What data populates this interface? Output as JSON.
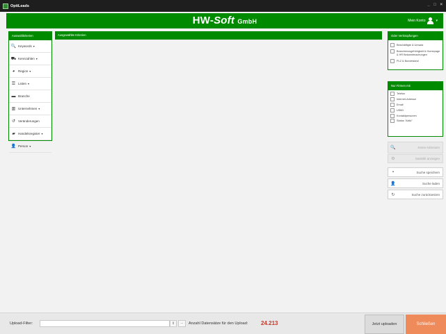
{
  "window": {
    "title": "OptiLeads",
    "controls": "_ □ ×"
  },
  "header": {
    "brand_prefix": "HW-",
    "brand_soft": "Soft",
    "brand_suffix": "GmbH",
    "account_label": "Mein Konto",
    "account_caret": "▾"
  },
  "left_panel": {
    "title": "Auswahlkriterien",
    "items": [
      {
        "label": "Keywords",
        "icon": "keyword-search-icon",
        "glyph": "🔍",
        "dropdown": true
      },
      {
        "label": "Kennzahlen",
        "icon": "cars-icon",
        "glyph": "⛟",
        "dropdown": true
      },
      {
        "label": "Region",
        "icon": "globe-icon",
        "glyph": "◕",
        "dropdown": true
      },
      {
        "label": "Listen",
        "icon": "list-icon",
        "glyph": "☰",
        "dropdown": true
      },
      {
        "label": "Branche",
        "icon": "briefcase-icon",
        "glyph": "▬",
        "dropdown": false
      },
      {
        "label": "Unternehmen",
        "icon": "building-icon",
        "glyph": "▥",
        "dropdown": true
      },
      {
        "label": "Veränderungen",
        "icon": "history-icon",
        "glyph": "↺",
        "dropdown": false
      },
      {
        "label": "Handelsregister",
        "icon": "book-icon",
        "glyph": "▰",
        "dropdown": true
      },
      {
        "label": "Person",
        "icon": "person-icon",
        "glyph": "👤",
        "dropdown": true
      }
    ],
    "caret": "▾"
  },
  "center_panel": {
    "title": "Ausgewählte Kriterien"
  },
  "right_panel_1": {
    "title": "Oder Verknüpfungen",
    "options": [
      "Beschäftigte & Umsatz",
      "Branchenzugehörigkeit & Homepage & HR Bekanntmachungen",
      "PLZ & Bundesland"
    ]
  },
  "right_panel_2": {
    "title": "Nur Firmen mit",
    "options": [
      "Telefon",
      "Internet-Adresse",
      "Email",
      "UStID",
      "Kontaktpersonen",
      "Status \"Aktiv\""
    ]
  },
  "side_buttons": {
    "keine_adressen": "Keine Adressen",
    "statistik": "Statistik anzeigen",
    "suche_speichern": "Suche speichern",
    "suche_laden": "Suche laden",
    "suche_zuruecksetzen": "Suche zurücksetzen"
  },
  "footer": {
    "filter_label": "Upload-Filter:",
    "filter_value": "",
    "spin_glyph": "⇕",
    "dots": "...",
    "count_label": "Anzahl Datensätze für den Upload:",
    "count_value": "24.213",
    "upload_label": "Jetzt uploaden",
    "close_label": "Schließen"
  },
  "colors": {
    "brand_green": "#008a00",
    "close_orange": "#ef8a5b",
    "count_red": "#c0392b"
  }
}
